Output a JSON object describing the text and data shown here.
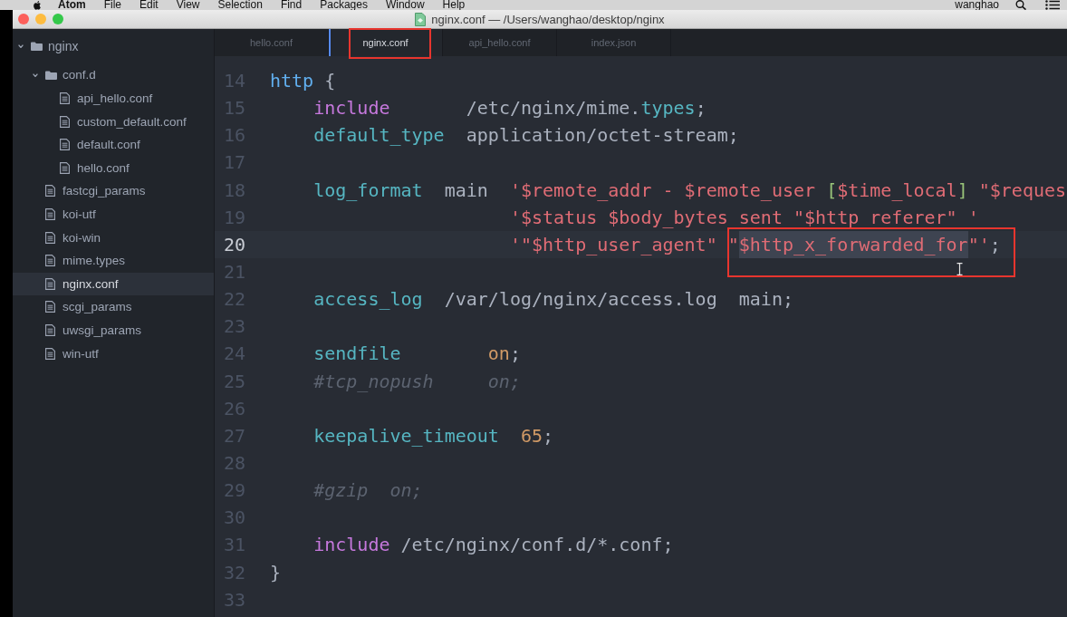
{
  "menu_bar": {
    "items": [
      "Atom",
      "File",
      "Edit",
      "View",
      "Selection",
      "Find",
      "Packages",
      "Window",
      "Help"
    ],
    "user": "wanghao"
  },
  "window": {
    "title": "nginx.conf — /Users/wanghao/desktop/nginx"
  },
  "tree": {
    "label": "nginx",
    "kind": "folder",
    "expanded": true,
    "selected": false,
    "children": [
      {
        "label": "conf.d",
        "kind": "folder",
        "expanded": true,
        "selected": false,
        "children": [
          {
            "label": "api_hello.conf",
            "kind": "file",
            "selected": false
          },
          {
            "label": "custom_default.conf",
            "kind": "file",
            "selected": false
          },
          {
            "label": "default.conf",
            "kind": "file",
            "selected": false
          },
          {
            "label": "hello.conf",
            "kind": "file",
            "selected": false
          }
        ]
      },
      {
        "label": "fastcgi_params",
        "kind": "file",
        "selected": false
      },
      {
        "label": "koi-utf",
        "kind": "file",
        "selected": false
      },
      {
        "label": "koi-win",
        "kind": "file",
        "selected": false
      },
      {
        "label": "mime.types",
        "kind": "file",
        "selected": false
      },
      {
        "label": "nginx.conf",
        "kind": "file",
        "selected": true
      },
      {
        "label": "scgi_params",
        "kind": "file",
        "selected": false
      },
      {
        "label": "uwsgi_params",
        "kind": "file",
        "selected": false
      },
      {
        "label": "win-utf",
        "kind": "file",
        "selected": false
      }
    ]
  },
  "tabs": [
    {
      "label": "hello.conf",
      "selected": false
    },
    {
      "label": "nginx.conf",
      "selected": true
    },
    {
      "label": "api_hello.conf",
      "selected": false
    },
    {
      "label": "index.json",
      "selected": false
    }
  ],
  "editor": {
    "lines": [
      {
        "number": "14",
        "current": false,
        "tokens": [
          {
            "kind": "block",
            "text": "http",
            "selected": false
          },
          {
            "kind": "plain",
            "text": " {",
            "selected": false
          }
        ]
      },
      {
        "number": "15",
        "current": false,
        "tokens": [
          {
            "kind": "keyword",
            "text": "    include",
            "selected": false
          },
          {
            "kind": "plain",
            "text": "       /etc/nginx/mime.",
            "selected": false
          },
          {
            "kind": "directive",
            "text": "types",
            "selected": false
          },
          {
            "kind": "plain",
            "text": ";",
            "selected": false
          }
        ]
      },
      {
        "number": "16",
        "current": false,
        "tokens": [
          {
            "kind": "directive",
            "text": "    default_type",
            "selected": false
          },
          {
            "kind": "plain",
            "text": "  application/octet-stream;",
            "selected": false
          }
        ]
      },
      {
        "number": "17",
        "current": false
      },
      {
        "number": "18",
        "current": false,
        "tokens": [
          {
            "kind": "directive",
            "text": "    log_format",
            "selected": false
          },
          {
            "kind": "plain",
            "text": "  main  ",
            "selected": false
          },
          {
            "kind": "string",
            "text": "'$remote_addr - $remote_user ",
            "selected": false
          },
          {
            "kind": "bracket",
            "text": "[",
            "selected": false
          },
          {
            "kind": "string",
            "text": "$time_local",
            "selected": false
          },
          {
            "kind": "bracket",
            "text": "]",
            "selected": false
          },
          {
            "kind": "string",
            "text": " \"$reques",
            "selected": false
          }
        ]
      },
      {
        "number": "19",
        "current": false,
        "tokens": [
          {
            "kind": "string",
            "text": "                      '$status $body_bytes_sent \"$http_referer\" '",
            "selected": false
          }
        ]
      },
      {
        "number": "20",
        "current": true,
        "tokens": [
          {
            "kind": "string",
            "text": "                      '\"$http_user_agent\" \"",
            "selected": false
          },
          {
            "kind": "string",
            "text": "$http_x_forwarded_for",
            "selected": true
          },
          {
            "kind": "string",
            "text": "\"'",
            "selected": false
          },
          {
            "kind": "plain",
            "text": ";",
            "selected": false
          }
        ]
      },
      {
        "number": "21",
        "current": false
      },
      {
        "number": "22",
        "current": false,
        "tokens": [
          {
            "kind": "directive",
            "text": "    access_log",
            "selected": false
          },
          {
            "kind": "plain",
            "text": "  /var/log/nginx/access.log  main;",
            "selected": false
          }
        ]
      },
      {
        "number": "23",
        "current": false
      },
      {
        "number": "24",
        "current": false,
        "tokens": [
          {
            "kind": "directive",
            "text": "    sendfile        ",
            "selected": false
          },
          {
            "kind": "constant",
            "text": "on",
            "selected": false
          },
          {
            "kind": "plain",
            "text": ";",
            "selected": false
          }
        ]
      },
      {
        "number": "25",
        "current": false,
        "tokens": [
          {
            "kind": "comment",
            "text": "    #tcp_nopush     on;",
            "selected": false
          }
        ]
      },
      {
        "number": "26",
        "current": false
      },
      {
        "number": "27",
        "current": false,
        "tokens": [
          {
            "kind": "directive",
            "text": "    keepalive_timeout  ",
            "selected": false
          },
          {
            "kind": "constant",
            "text": "65",
            "selected": false
          },
          {
            "kind": "plain",
            "text": ";",
            "selected": false
          }
        ]
      },
      {
        "number": "28",
        "current": false
      },
      {
        "number": "29",
        "current": false,
        "tokens": [
          {
            "kind": "comment",
            "text": "    #gzip  on;",
            "selected": false
          }
        ]
      },
      {
        "number": "30",
        "current": false
      },
      {
        "number": "31",
        "current": false,
        "tokens": [
          {
            "kind": "keyword",
            "text": "    include",
            "selected": false
          },
          {
            "kind": "plain",
            "text": " /etc/nginx/conf.d/*.conf;",
            "selected": false
          }
        ]
      },
      {
        "number": "32",
        "current": false,
        "tokens": [
          {
            "kind": "plain",
            "text": "}",
            "selected": false
          }
        ]
      },
      {
        "number": "33",
        "current": false
      }
    ]
  }
}
